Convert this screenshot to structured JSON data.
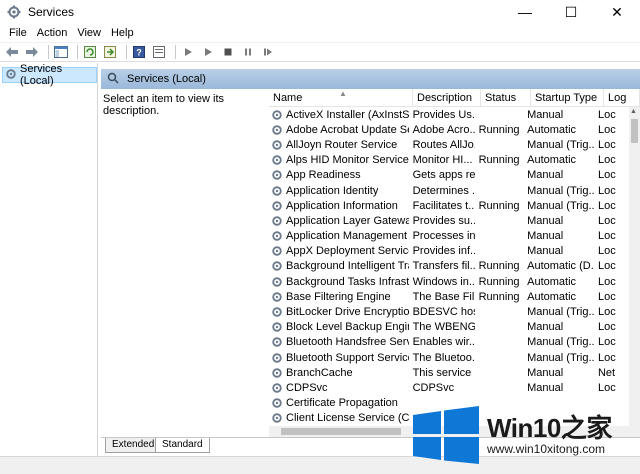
{
  "window": {
    "title": "Services",
    "icon": "gear-icon",
    "controls": [
      "—",
      "☐",
      "✕"
    ]
  },
  "menu": [
    "File",
    "Action",
    "View",
    "Help"
  ],
  "tree": {
    "item_label": "Services (Local)"
  },
  "main": {
    "header_label": "Services (Local)",
    "description_prompt": "Select an item to view its description.",
    "columns": {
      "name": "Name",
      "description": "Description",
      "status": "Status",
      "startup": "Startup Type",
      "logon": "Log"
    },
    "services": [
      {
        "name": "ActiveX Installer (AxInstSV)",
        "description": "Provides Us...",
        "status": "",
        "startup": "Manual",
        "logon": "Loc"
      },
      {
        "name": "Adobe Acrobat Update Serv...",
        "description": "Adobe Acro...",
        "status": "Running",
        "startup": "Automatic",
        "logon": "Loc"
      },
      {
        "name": "AllJoyn Router Service",
        "description": "Routes AllJo...",
        "status": "",
        "startup": "Manual (Trig...",
        "logon": "Loc"
      },
      {
        "name": "Alps HID Monitor Service",
        "description": "Monitor HI...",
        "status": "Running",
        "startup": "Automatic",
        "logon": "Loc"
      },
      {
        "name": "App Readiness",
        "description": "Gets apps re...",
        "status": "",
        "startup": "Manual",
        "logon": "Loc"
      },
      {
        "name": "Application Identity",
        "description": "Determines ...",
        "status": "",
        "startup": "Manual (Trig...",
        "logon": "Loc"
      },
      {
        "name": "Application Information",
        "description": "Facilitates t...",
        "status": "Running",
        "startup": "Manual (Trig...",
        "logon": "Loc"
      },
      {
        "name": "Application Layer Gateway ...",
        "description": "Provides su...",
        "status": "",
        "startup": "Manual",
        "logon": "Loc"
      },
      {
        "name": "Application Management",
        "description": "Processes in...",
        "status": "",
        "startup": "Manual",
        "logon": "Loc"
      },
      {
        "name": "AppX Deployment Service (...",
        "description": "Provides inf...",
        "status": "",
        "startup": "Manual",
        "logon": "Loc"
      },
      {
        "name": "Background Intelligent Tran...",
        "description": "Transfers fil...",
        "status": "Running",
        "startup": "Automatic (D...",
        "logon": "Loc"
      },
      {
        "name": "Background Tasks Infrastru...",
        "description": "Windows in...",
        "status": "Running",
        "startup": "Automatic",
        "logon": "Loc"
      },
      {
        "name": "Base Filtering Engine",
        "description": "The Base Fil...",
        "status": "Running",
        "startup": "Automatic",
        "logon": "Loc"
      },
      {
        "name": "BitLocker Drive Encryption ...",
        "description": "BDESVC hos...",
        "status": "",
        "startup": "Manual (Trig...",
        "logon": "Loc"
      },
      {
        "name": "Block Level Backup Engine ...",
        "description": "The WBENG...",
        "status": "",
        "startup": "Manual",
        "logon": "Loc"
      },
      {
        "name": "Bluetooth Handsfree Service",
        "description": "Enables wir...",
        "status": "",
        "startup": "Manual (Trig...",
        "logon": "Loc"
      },
      {
        "name": "Bluetooth Support Service",
        "description": "The Bluetoo...",
        "status": "",
        "startup": "Manual (Trig...",
        "logon": "Loc"
      },
      {
        "name": "BranchCache",
        "description": "This service ...",
        "status": "",
        "startup": "Manual",
        "logon": "Net"
      },
      {
        "name": "CDPSvc",
        "description": "CDPSvc",
        "status": "",
        "startup": "Manual",
        "logon": "Loc"
      },
      {
        "name": "Certificate Propagation",
        "description": "",
        "status": "",
        "startup": "",
        "logon": ""
      },
      {
        "name": "Client License Service (ClipS...",
        "description": "",
        "status": "",
        "startup": "",
        "logon": ""
      }
    ]
  },
  "tabs": [
    "Extended",
    "Standard"
  ],
  "watermark": {
    "title": "Win10之家",
    "url": "www.win10xitong.com",
    "colors": {
      "blue": "#0f78d7"
    }
  }
}
